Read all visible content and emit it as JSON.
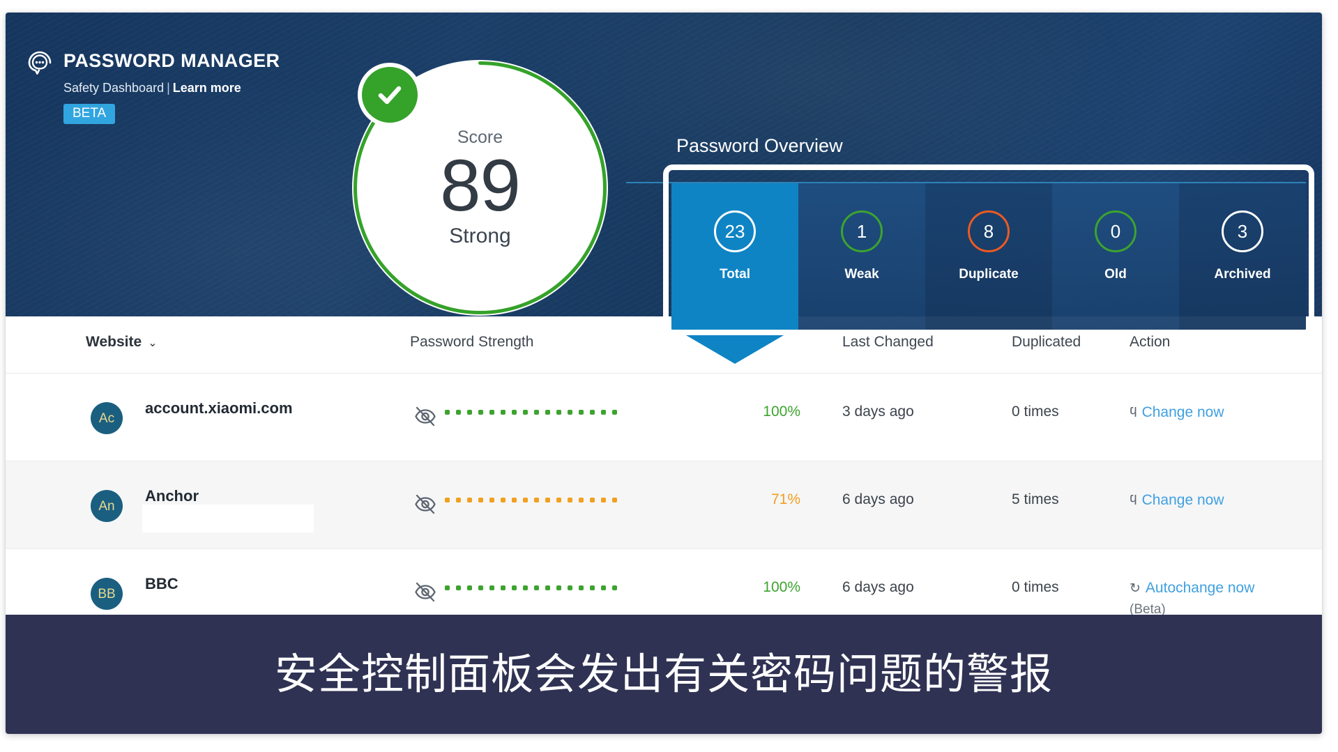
{
  "app": {
    "brand_title": "PASSWORD MANAGER",
    "subtitle": "Safety Dashboard",
    "separator": "|",
    "learn_more": "Learn more",
    "beta_badge": "BETA"
  },
  "score": {
    "label": "Score",
    "value": "89",
    "state": "Strong",
    "percent": 89,
    "ring_color": "#35a22a",
    "check_color": "#35a22a"
  },
  "overview": {
    "title": "Password Overview",
    "cards": [
      {
        "count": "23",
        "label": "Total",
        "ring": "#ffffff",
        "selected": true
      },
      {
        "count": "1",
        "label": "Weak",
        "ring": "#3da32f",
        "selected": false
      },
      {
        "count": "8",
        "label": "Duplicate",
        "ring": "#ec5a22",
        "selected": false
      },
      {
        "count": "0",
        "label": "Old",
        "ring": "#3da32f",
        "selected": false
      },
      {
        "count": "3",
        "label": "Archived",
        "ring": "#ffffff",
        "selected": false
      }
    ]
  },
  "table": {
    "columns": {
      "website": "Website",
      "strength": "Password Strength",
      "last_changed": "Last Changed",
      "duplicated": "Duplicated",
      "action": "Action"
    },
    "rows": [
      {
        "initials": "Ac",
        "site": "account.xiaomi.com",
        "redacted": false,
        "dot_count": 16,
        "strength_color": "green",
        "percent": "100%",
        "last_changed": "3 days ago",
        "duplicated": "0 times",
        "action": "Change now",
        "action_icon": "external-link-icon",
        "action_sub": ""
      },
      {
        "initials": "An",
        "site": "Anchor",
        "redacted": true,
        "dot_count": 16,
        "strength_color": "orange",
        "percent": "71%",
        "last_changed": "6 days ago",
        "duplicated": "5 times",
        "action": "Change now",
        "action_icon": "external-link-icon",
        "action_sub": ""
      },
      {
        "initials": "BB",
        "site": "BBC",
        "redacted": false,
        "dot_count": 16,
        "strength_color": "green",
        "percent": "100%",
        "last_changed": "6 days ago",
        "duplicated": "0 times",
        "action": "Autochange now",
        "action_icon": "refresh-icon",
        "action_sub": "(Beta)"
      }
    ]
  },
  "caption": {
    "text": "安全控制面板会发出有关密码问题的警报"
  },
  "colors": {
    "header_navy": "#1b3f69",
    "accent_blue": "#0e84c4",
    "beta_blue": "#31a5e0",
    "green": "#3da32f",
    "orange": "#ec5a22",
    "amber": "#f1a01e",
    "link_blue": "#3fa0e0",
    "caption_bg": "#2f3253"
  }
}
